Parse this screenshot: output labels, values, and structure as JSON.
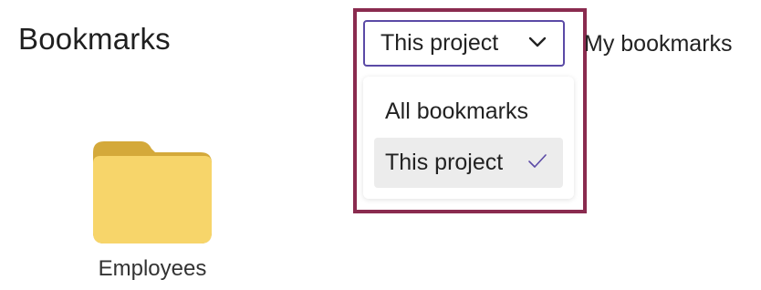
{
  "header": {
    "title": "Bookmarks"
  },
  "scope_filter": {
    "selected": "This project",
    "options": [
      {
        "label": "All bookmarks",
        "selected": false
      },
      {
        "label": "This project",
        "selected": true
      }
    ]
  },
  "tabs": {
    "my_bookmarks": "My bookmarks"
  },
  "folders": [
    {
      "name": "Employees",
      "icon": "folder-icon"
    }
  ],
  "colors": {
    "select_border": "#5b4aa6",
    "highlight_frame": "#8a2b4f",
    "check_mark": "#5b4aa6",
    "folder_front": "#f7d56a",
    "folder_back": "#d4a93a",
    "selected_item_bg": "#ececec"
  }
}
